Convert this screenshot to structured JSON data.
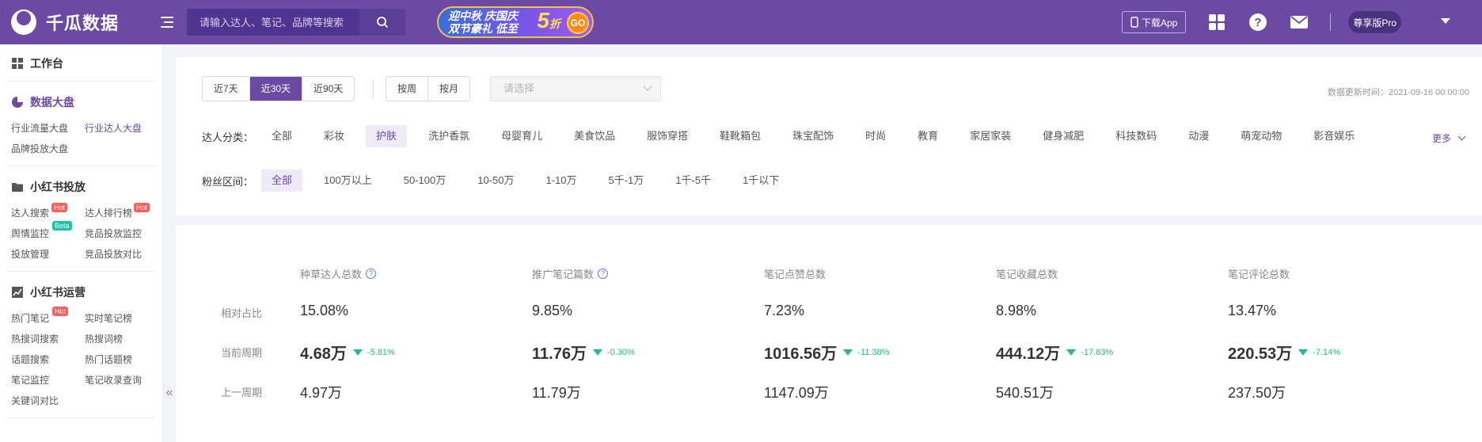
{
  "header": {
    "brand": "千瓜数据",
    "search_placeholder": "请输入达人、笔记、品牌等搜索",
    "promo": {
      "line1": "迎中秋 庆国庆",
      "line2": "双节豪礼 低至",
      "discount": "5",
      "discount_unit": "折",
      "go": "GO"
    },
    "download_app": "下载App",
    "plan": "尊享版Pro"
  },
  "sidebar": {
    "sections": [
      {
        "title": "工作台",
        "links": []
      },
      {
        "title": "数据大盘",
        "links": [
          {
            "label": "行业流量大盘"
          },
          {
            "label": "行业达人大盘",
            "active": true
          },
          {
            "label": "品牌投放大盘"
          }
        ]
      },
      {
        "title": "小红书投放",
        "links": [
          {
            "label": "达人搜索",
            "tag": "Hot"
          },
          {
            "label": "达人排行榜",
            "tag": "Hot"
          },
          {
            "label": "舆情监控",
            "tag": "Beta"
          },
          {
            "label": "竞品投放监控"
          },
          {
            "label": "投放管理"
          },
          {
            "label": "竞品投放对比"
          }
        ]
      },
      {
        "title": "小红书运营",
        "links": [
          {
            "label": "热门笔记",
            "tag": "Hot"
          },
          {
            "label": "实时笔记榜"
          },
          {
            "label": "热搜词搜索"
          },
          {
            "label": "热搜词榜"
          },
          {
            "label": "话题搜索"
          },
          {
            "label": "热门话题榜"
          },
          {
            "label": "笔记监控"
          },
          {
            "label": "笔记收录查询"
          },
          {
            "label": "关键词对比"
          }
        ]
      }
    ],
    "collapse_glyph": "«"
  },
  "filters": {
    "date_ranges": [
      "近7天",
      "近30天",
      "近90天"
    ],
    "date_selected": 1,
    "granularity": [
      "按周",
      "按月"
    ],
    "select_placeholder": "请选择",
    "update_time": "数据更新时间：2021-09-16 00:00:00",
    "category_label": "达人分类：",
    "categories": [
      "全部",
      "彩妆",
      "护肤",
      "洗护香氛",
      "母婴育儿",
      "美食饮品",
      "服饰穿搭",
      "鞋靴箱包",
      "珠宝配饰",
      "时尚",
      "教育",
      "家居家装",
      "健身减肥",
      "科技数码",
      "动漫",
      "萌宠动物",
      "影音娱乐"
    ],
    "category_selected": 2,
    "more_label": "更多",
    "fans_label": "粉丝区间：",
    "fans_ranges": [
      "全部",
      "100万以上",
      "50-100万",
      "10-50万",
      "1-10万",
      "5千-1万",
      "1千-5千",
      "1千以下"
    ],
    "fans_selected": 0
  },
  "stats": {
    "row_labels": [
      "相对占比",
      "当前周期",
      "上一周期"
    ],
    "columns": [
      {
        "title": "种草达人总数",
        "help": true,
        "ratio": "15.08%",
        "current": "4.68万",
        "delta": "-5.81%",
        "previous": "4.97万"
      },
      {
        "title": "推广笔记篇数",
        "help": true,
        "ratio": "9.85%",
        "current": "11.76万",
        "delta": "-0.30%",
        "previous": "11.79万"
      },
      {
        "title": "笔记点赞总数",
        "help": false,
        "ratio": "7.23%",
        "current": "1016.56万",
        "delta": "-11.38%",
        "previous": "1147.09万"
      },
      {
        "title": "笔记收藏总数",
        "help": false,
        "ratio": "8.98%",
        "current": "444.12万",
        "delta": "-17.83%",
        "previous": "540.51万"
      },
      {
        "title": "笔记评论总数",
        "help": false,
        "ratio": "13.47%",
        "current": "220.53万",
        "delta": "-7.14%",
        "previous": "237.50万"
      }
    ]
  },
  "colors": {
    "brand": "#6a4aa2",
    "down": "#27b89a",
    "hot": "#f5615c",
    "beta": "#1fc3a1"
  }
}
